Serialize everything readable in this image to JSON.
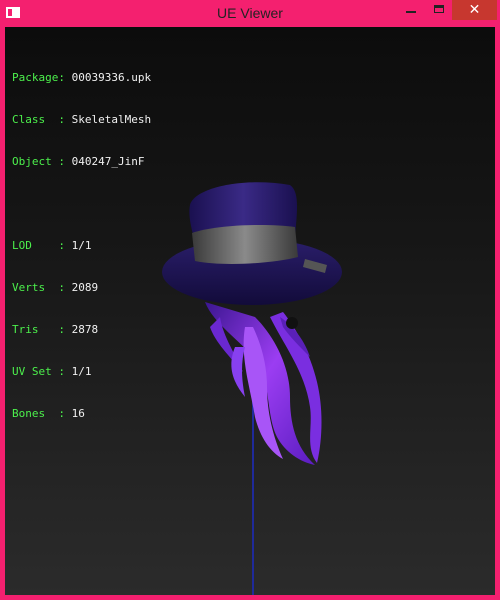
{
  "window": {
    "title": "UE Viewer",
    "close_glyph": "✕"
  },
  "info": {
    "rows1": [
      {
        "label": "Package: ",
        "value": "00039336.upk"
      },
      {
        "label": "Class  : ",
        "value": "SkeletalMesh"
      },
      {
        "label": "Object : ",
        "value": "040247_JinF"
      }
    ],
    "rows2": [
      {
        "label": "LOD    : ",
        "value": "1/1"
      },
      {
        "label": "Verts  : ",
        "value": "2089"
      },
      {
        "label": "Tris   : ",
        "value": "2878"
      },
      {
        "label": "UV Set : ",
        "value": "1/1"
      },
      {
        "label": "Bones  : ",
        "value": "16"
      }
    ]
  },
  "colors": {
    "accent": "#f4206f",
    "label": "#4cf04c",
    "value": "#f0f0f0",
    "axis": "#1f2a9a"
  }
}
